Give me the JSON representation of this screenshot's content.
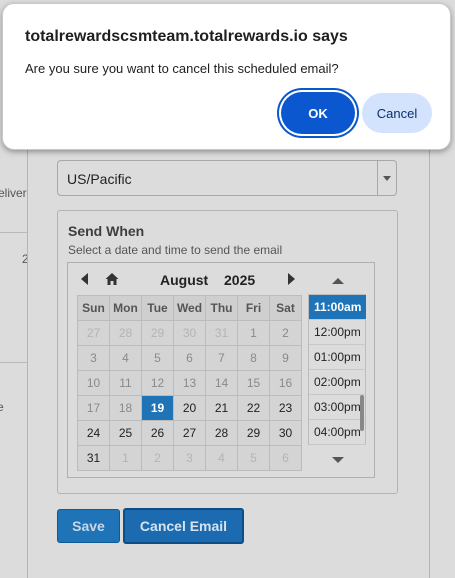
{
  "background": {
    "edge_fragment_1": "eliver",
    "edge_fragment_2": "2",
    "edge_fragment_3": "e"
  },
  "form": {
    "timezone": "US/Pacific",
    "send_when": {
      "title": "Send When",
      "subtitle": "Select a date and time to send the email"
    },
    "calendar": {
      "month": "August",
      "year": "2025",
      "weekdays": [
        "Sun",
        "Mon",
        "Tue",
        "Wed",
        "Thu",
        "Fri",
        "Sat"
      ],
      "weeks": [
        [
          "27",
          "28",
          "29",
          "30",
          "31",
          "1",
          "2"
        ],
        [
          "3",
          "4",
          "5",
          "6",
          "7",
          "8",
          "9"
        ],
        [
          "10",
          "11",
          "12",
          "13",
          "14",
          "15",
          "16"
        ],
        [
          "17",
          "18",
          "19",
          "20",
          "21",
          "22",
          "23"
        ],
        [
          "24",
          "25",
          "26",
          "27",
          "28",
          "29",
          "30"
        ],
        [
          "31",
          "1",
          "2",
          "3",
          "4",
          "5",
          "6"
        ]
      ],
      "selected_day": "19"
    },
    "times": [
      "11:00am",
      "12:00pm",
      "01:00pm",
      "02:00pm",
      "03:00pm",
      "04:00pm"
    ],
    "selected_time": "11:00am",
    "save_label": "Save",
    "cancel_email_label": "Cancel Email"
  },
  "dialog": {
    "title": "totalrewardscsmteam.totalrewards.io says",
    "message": "Are you sure you want to cancel this scheduled email?",
    "ok_label": "OK",
    "cancel_label": "Cancel",
    "ok_color": "#0b57d0",
    "cancel_color": "#d3e3fd"
  }
}
